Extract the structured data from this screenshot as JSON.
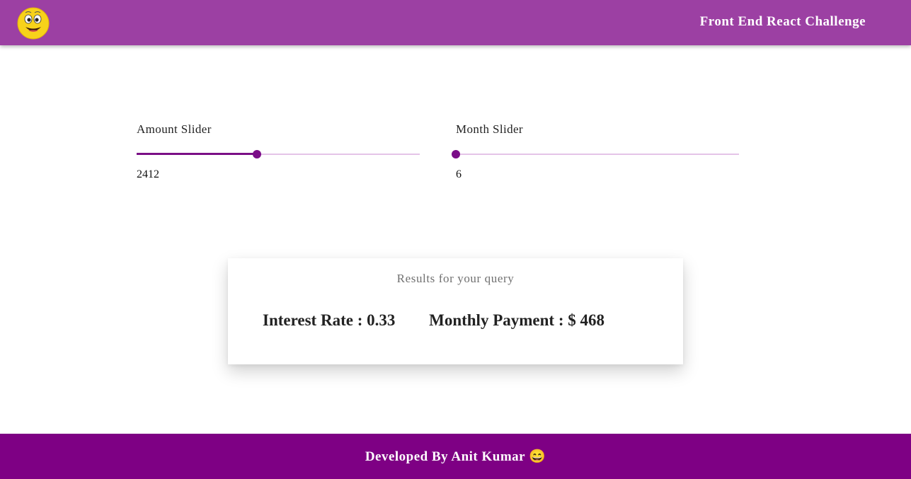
{
  "header": {
    "title": "Front End React Challenge",
    "logo_icon": "smiley-face-icon"
  },
  "amount_slider": {
    "label": "Amount Slider",
    "value": "2412",
    "fill_fraction": 0.425
  },
  "month_slider": {
    "label": "Month Slider",
    "value": "6",
    "fill_fraction": 0.0
  },
  "results": {
    "heading": "Results for your query",
    "interest_rate": "Interest Rate : 0.33",
    "monthly_payment": "Monthly Payment : $ 468"
  },
  "footer": {
    "text": "Developed By Anit Kumar 😄"
  },
  "colors": {
    "header_bg": "#9c40a3",
    "footer_bg": "#7e0084",
    "slider_active": "#7a0f86",
    "slider_rail": "#e4c4e8"
  }
}
